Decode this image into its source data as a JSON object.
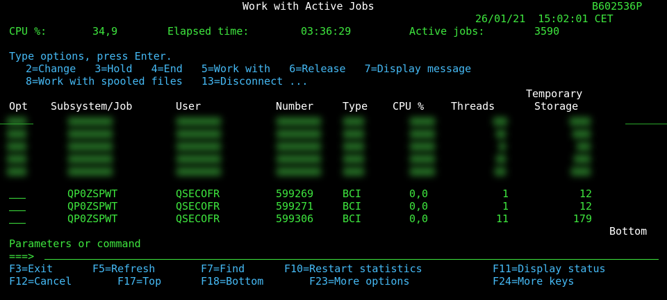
{
  "header": {
    "title": "Work with Active Jobs",
    "system": "B602536P",
    "datetime": "26/01/21  15:02:01 CET"
  },
  "stats": {
    "cpu_label": "CPU %:",
    "cpu_value": "34,9",
    "elapsed_label": "Elapsed time:",
    "elapsed_value": "03:36:29",
    "active_label": "Active jobs:",
    "active_value": "3590"
  },
  "instructions": {
    "line1": "Type options, press Enter.",
    "line2": "2=Change   3=Hold   4=End   5=Work with   6=Release   7=Display message",
    "line3": "8=Work with spooled files   13=Disconnect ..."
  },
  "columns": {
    "opt": "Opt",
    "subsystem_job": "Subsystem/Job",
    "user": "User",
    "number": "Number",
    "type": "Type",
    "cpu": "CPU %",
    "threads": "Threads",
    "temp_top": "Temporary",
    "temp_bottom": "Storage"
  },
  "rows": [
    {
      "opt": "",
      "job": "QP0ZSPWT",
      "user": "QSECOFR",
      "number": "599269",
      "type": "BCI",
      "cpu": "0,0",
      "threads": "1",
      "storage": "12"
    },
    {
      "opt": "",
      "job": "QP0ZSPWT",
      "user": "QSECOFR",
      "number": "599271",
      "type": "BCI",
      "cpu": "0,0",
      "threads": "1",
      "storage": "12"
    },
    {
      "opt": "",
      "job": "QP0ZSPWT",
      "user": "QSECOFR",
      "number": "599306",
      "type": "BCI",
      "cpu": "0,0",
      "threads": "11",
      "storage": "179"
    }
  ],
  "list_status": "Bottom",
  "command": {
    "label": "Parameters or command",
    "prompt": "===>",
    "value": ""
  },
  "function_keys": {
    "f3": "F3=Exit",
    "f5": "F5=Refresh",
    "f7": "F7=Find",
    "f10": "F10=Restart statistics",
    "f11": "F11=Display status",
    "f12": "F12=Cancel",
    "f17": "F17=Top",
    "f18": "F18=Bottom",
    "f23": "F23=More options",
    "f24": "F24=More keys"
  },
  "colors": {
    "background": "#000000",
    "text_green": "#3ee63e",
    "text_white": "#ffffff",
    "text_cyan": "#45b9f4"
  }
}
